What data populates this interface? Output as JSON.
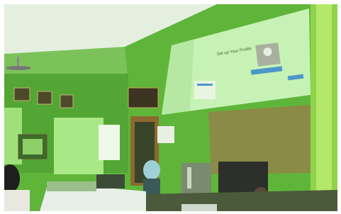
{
  "scene": {
    "projected_slide": {
      "heading": "Set up Your Profile"
    }
  },
  "colors": {
    "wall": "#5fb53a",
    "ceiling": "#e4efe0",
    "projection": "#c7f2b6",
    "whiteboard": "#8a8b47",
    "accent_blue": "#4b97c9"
  }
}
